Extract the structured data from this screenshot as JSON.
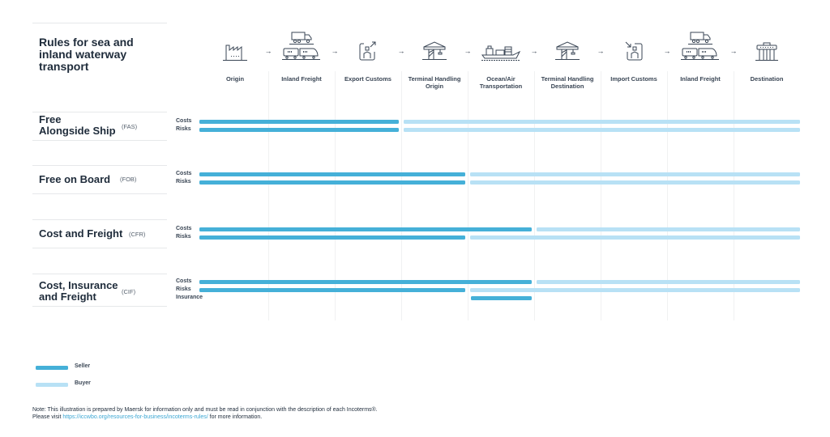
{
  "title": "Rules for sea and inland waterway transport",
  "colors": {
    "seller": "#45b0d8",
    "buyer": "#b8e1f5",
    "text": "#1e2b3a"
  },
  "stages": [
    {
      "label": "Origin",
      "icon": "factory-icon"
    },
    {
      "label": "Inland Freight",
      "icon": "truck-train-icon"
    },
    {
      "label": "Export Customs",
      "icon": "export-customs-icon"
    },
    {
      "label": "Terminal Handling Origin",
      "icon": "terminal-crane-icon"
    },
    {
      "label": "Ocean/Air Transportation",
      "icon": "ship-icon"
    },
    {
      "label": "Terminal Handling Destination",
      "icon": "terminal-crane-icon"
    },
    {
      "label": "Import Customs",
      "icon": "import-customs-icon"
    },
    {
      "label": "Inland Freight",
      "icon": "truck-train-icon"
    },
    {
      "label": "Destination",
      "icon": "warehouse-icon"
    }
  ],
  "arrow_glyph": "→",
  "terms": [
    {
      "name_lines": [
        "Free",
        "Alongside Ship"
      ],
      "code": "(FAS)",
      "rows": [
        {
          "label": "Costs",
          "seller_until_stage": 3
        },
        {
          "label": "Risks",
          "seller_until_stage": 3
        }
      ]
    },
    {
      "name_lines": [
        "Free on Board"
      ],
      "code": "(FOB)",
      "rows": [
        {
          "label": "Costs",
          "seller_until_stage": 4
        },
        {
          "label": "Risks",
          "seller_until_stage": 4
        }
      ]
    },
    {
      "name_lines": [
        "Cost and Freight"
      ],
      "code": "(CFR)",
      "rows": [
        {
          "label": "Costs",
          "seller_until_stage": 5
        },
        {
          "label": "Risks",
          "seller_until_stage": 4
        }
      ]
    },
    {
      "name_lines": [
        "Cost, Insurance",
        "and Freight"
      ],
      "code": "(CIF)",
      "rows": [
        {
          "label": "Costs",
          "seller_until_stage": 5
        },
        {
          "label": "Risks",
          "seller_until_stage": 4
        },
        {
          "label": "Insurance",
          "seller_stage_range": [
            5,
            5
          ]
        }
      ]
    }
  ],
  "legend": [
    {
      "label": "Seller",
      "party": "seller"
    },
    {
      "label": "Buyer",
      "party": "buyer"
    }
  ],
  "note": {
    "line1": "Note: This illustration is prepared by Maersk for information only and must be read in conjunction with the description of each Incoterms®.",
    "line2_prefix": "Please visit ",
    "link": "https://iccwbo.org/resources-for-business/incoterms-rules/",
    "line2_suffix": " for more information."
  }
}
